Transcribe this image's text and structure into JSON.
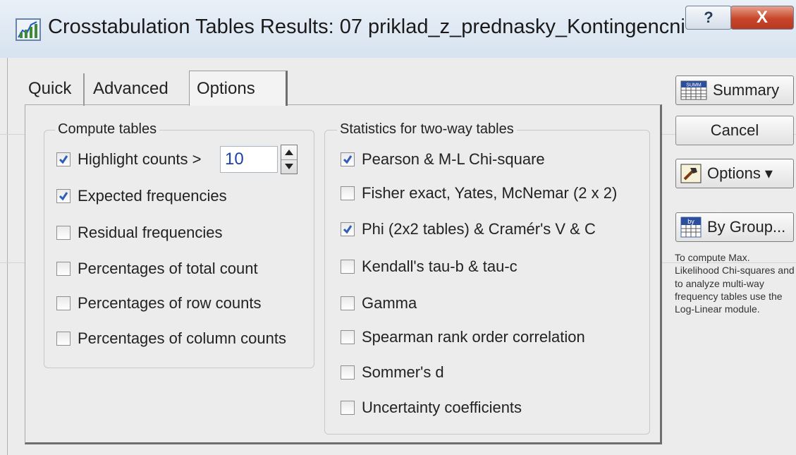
{
  "window": {
    "title": "Crosstabulation Tables Results: 07 priklad_z_prednasky_Kontingencni",
    "help_label": "?",
    "close_label": "X"
  },
  "tabs": [
    {
      "label": "Quick"
    },
    {
      "label": "Advanced"
    },
    {
      "label": "Options",
      "selected": true
    }
  ],
  "compute_tables": {
    "title": "Compute tables",
    "highlight": {
      "label": "Highlight counts >",
      "checked": true,
      "value": "10"
    },
    "items": [
      {
        "label": "Expected frequencies",
        "checked": true
      },
      {
        "label": "Residual frequencies",
        "checked": false
      },
      {
        "label": "Percentages of total count",
        "checked": false
      },
      {
        "label": "Percentages of row counts",
        "checked": false
      },
      {
        "label": "Percentages of column counts",
        "checked": false
      }
    ]
  },
  "statistics": {
    "title": "Statistics for two-way tables",
    "items": [
      {
        "label": "Pearson & M-L Chi-square",
        "checked": true
      },
      {
        "label": "Fisher exact, Yates, McNemar (2 x 2)",
        "checked": false
      },
      {
        "label": "Phi (2x2 tables) & Cramér's V &  C",
        "checked": true
      },
      {
        "label": "Kendall's tau-b & tau-c",
        "checked": false
      },
      {
        "label": "Gamma",
        "checked": false
      },
      {
        "label": "Spearman rank order correlation",
        "checked": false
      },
      {
        "label": "Sommer's d",
        "checked": false
      },
      {
        "label": "Uncertainty coefficients",
        "checked": false
      }
    ]
  },
  "buttons": {
    "summary": "Summary",
    "summary_icon_text": "SUMM",
    "cancel": "Cancel",
    "options": "Options ▾",
    "by_group": "By Group...",
    "by_group_icon_text": "by"
  },
  "note": "To compute Max. Likelihood Chi-squares and to analyze multi-way frequency tables use the Log-Linear module.",
  "colors": {
    "check": "#2f5fb4",
    "spinner_value": "#1d3fb0"
  }
}
